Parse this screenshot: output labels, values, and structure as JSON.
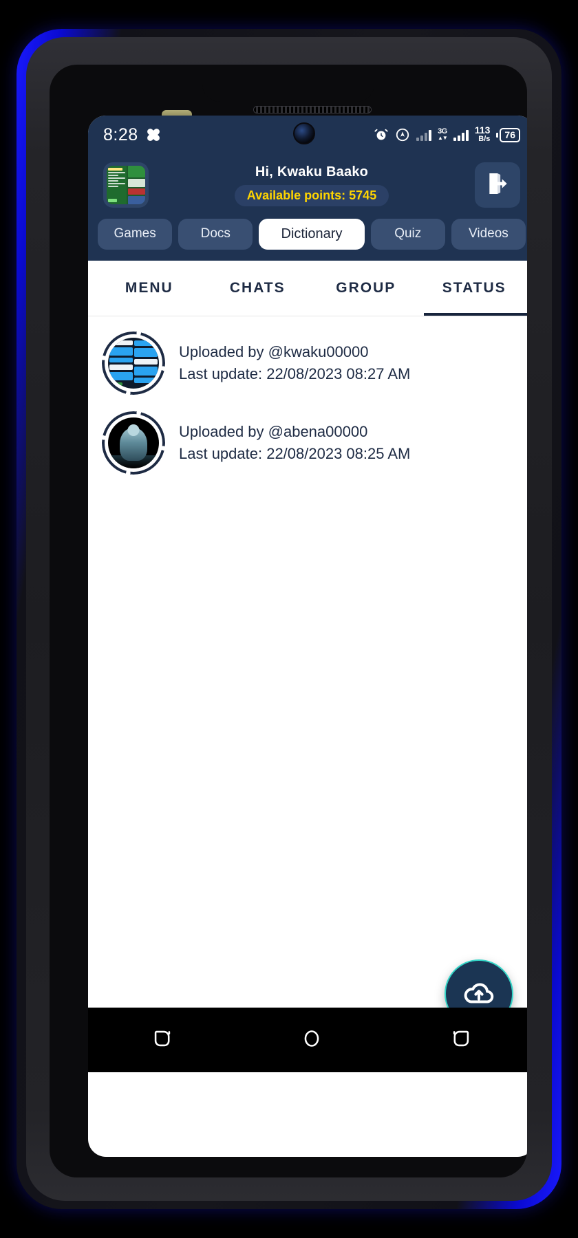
{
  "statusbar": {
    "time": "8:28",
    "left_icons": [
      "bandage-icon"
    ],
    "alarm_icon": "alarm-icon",
    "location_icon": "location-icon",
    "signal1_icon": "signal-bars-icon",
    "signal2_icon": "signal-bars-icon",
    "network_type": "3G",
    "network_arrows": "▲▼",
    "net_speed_value": "113",
    "net_speed_unit": "B/s",
    "battery_level": "76"
  },
  "header": {
    "app_icon": "app-thumbnail-icon",
    "greeting": "Hi, Kwaku Baako",
    "points_label": "Available points: 5745",
    "logout_icon": "logout-icon",
    "accent_navy": "#1f3352",
    "points_yellow": "#ffd500"
  },
  "categories": [
    {
      "label": "Games",
      "active": false
    },
    {
      "label": "Docs",
      "active": false
    },
    {
      "label": "Dictionary",
      "active": true
    },
    {
      "label": "Quiz",
      "active": false
    },
    {
      "label": "Videos",
      "active": false
    }
  ],
  "tabs": [
    {
      "label": "MENU",
      "active": false
    },
    {
      "label": "CHATS",
      "active": false
    },
    {
      "label": "GROUP",
      "active": false
    },
    {
      "label": "STATUS",
      "active": true
    }
  ],
  "status_list": [
    {
      "avatar": "chat-screenshot-avatar",
      "uploaded_by": "Uploaded by @kwaku00000",
      "last_update": "Last update: 22/08/2023 08:27 AM"
    },
    {
      "avatar": "figure-avatar",
      "uploaded_by": "Uploaded by @abena00000",
      "last_update": "Last update: 22/08/2023 08:25 AM"
    }
  ],
  "fab": {
    "icon": "cloud-upload-icon",
    "bg": "#1b3553",
    "ring": "#35d6c8"
  },
  "navbar": {
    "recents_icon": "recents-icon",
    "home_icon": "home-icon",
    "back_icon": "back-icon"
  }
}
